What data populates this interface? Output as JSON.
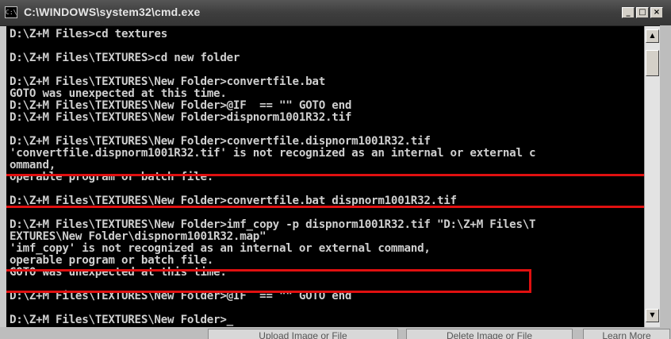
{
  "window": {
    "title": "C:\\WINDOWS\\system32\\cmd.exe",
    "icon_name": "cmd-icon",
    "icon_glyph": "C:\\",
    "minimize_glyph": "_",
    "maximize_glyph": "□",
    "close_glyph": "×"
  },
  "console": {
    "lines": [
      "D:\\Z+M Files>cd textures",
      "",
      "D:\\Z+M Files\\TEXTURES>cd new folder",
      "",
      "D:\\Z+M Files\\TEXTURES\\New Folder>convertfile.bat",
      "GOTO was unexpected at this time.",
      "D:\\Z+M Files\\TEXTURES\\New Folder>@IF  == \"\" GOTO end",
      "D:\\Z+M Files\\TEXTURES\\New Folder>dispnorm1001R32.tif",
      "",
      "D:\\Z+M Files\\TEXTURES\\New Folder>convertfile.dispnorm1001R32.tif",
      "'convertfile.dispnorm1001R32.tif' is not recognized as an internal or external c",
      "ommand,",
      "operable program or batch file.",
      "",
      "D:\\Z+M Files\\TEXTURES\\New Folder>convertfile.bat dispnorm1001R32.tif",
      "",
      "D:\\Z+M Files\\TEXTURES\\New Folder>imf_copy -p dispnorm1001R32.tif \"D:\\Z+M Files\\T",
      "EXTURES\\New Folder\\dispnorm1001R32.map\"",
      "'imf_copy' is not recognized as an internal or external command,",
      "operable program or batch file.",
      "GOTO was unexpected at this time.",
      "",
      "D:\\Z+M Files\\TEXTURES\\New Folder>@IF  == \"\" GOTO end",
      "",
      "D:\\Z+M Files\\TEXTURES\\New Folder>"
    ],
    "cursor": "_"
  },
  "scrollbar": {
    "up_glyph": "▲",
    "down_glyph": "▼"
  },
  "page_buttons": {
    "upload": "Upload Image or File",
    "delete": "Delete Image or File",
    "learn_more": "Learn More"
  },
  "colors": {
    "console_bg": "#000000",
    "console_text": "#cfcfcf",
    "highlight_box": "#e01010",
    "titlebar": "#3e3e3e"
  }
}
